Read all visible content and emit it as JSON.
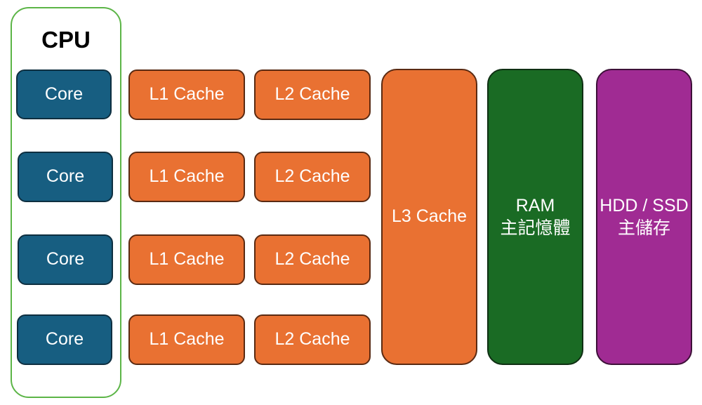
{
  "cpu": {
    "title": "CPU",
    "cores": [
      "Core",
      "Core",
      "Core",
      "Core"
    ]
  },
  "l1": [
    "L1 Cache",
    "L1 Cache",
    "L1 Cache",
    "L1 Cache"
  ],
  "l2": [
    "L2 Cache",
    "L2 Cache",
    "L2 Cache",
    "L2 Cache"
  ],
  "l3": {
    "label": "L3 Cache"
  },
  "ram": {
    "label": "RAM",
    "sublabel": "主記憶體"
  },
  "storage": {
    "label": "HDD / SSD",
    "sublabel": "主儲存"
  },
  "colors": {
    "cpu_border": "#5cb547",
    "core": "#175e81",
    "cache": "#e97132",
    "ram": "#1a6b24",
    "storage": "#a02b93"
  }
}
